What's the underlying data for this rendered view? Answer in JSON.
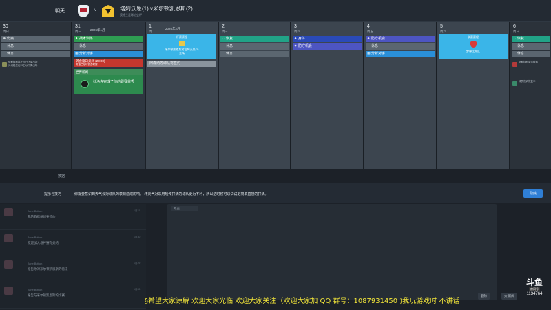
{
  "header": {
    "label": "明天",
    "vs": "v",
    "match_title": "塔姆沃思(1) v米尔顿凯恩斯(2)",
    "match_sub": "英格兰足球协会杯",
    "home_crest": "tamworth-crest-icon",
    "away_crest": "mk-dons-crest-icon"
  },
  "calendar": {
    "columns": [
      {
        "num": "30",
        "day": "周日",
        "cells": [
          "伤病",
          "休息",
          "休息"
        ]
      },
      {
        "num": "31",
        "day": "周一",
        "header_extra": "2026年1月",
        "cells": [
          "战术训练",
          "休息",
          "分析对手"
        ]
      },
      {
        "num": "1",
        "day": "周二",
        "header_extra": "2026年2月",
        "event_title": "杯赛赛程",
        "event_text": "米尔顿凯恩斯对塔姆沃思(2)",
        "event_tag": "主场"
      },
      {
        "num": "2",
        "day": "周三",
        "cells": [
          "恢复",
          "休息",
          "休息"
        ]
      },
      {
        "num": "3",
        "day": "周四",
        "cells": [
          "身体",
          "防守机会"
        ]
      },
      {
        "num": "4",
        "day": "周五",
        "cells": [
          "防守机会",
          "休息",
          "分析对手"
        ]
      },
      {
        "num": "5",
        "day": "周六",
        "event_title": "联赛赛程",
        "event_text": "梦想之湖队"
      },
      {
        "num": "6",
        "day": "周日",
        "cells": [
          "恢复",
          "休息",
          "休息"
        ]
      }
    ],
    "col0_notice": "伊斯特利将在25日下周出场\n对维格兰在25日以下周出场",
    "col1_deadline": "转会窗口关闭 (23:00)",
    "col1_deadline_sub": "英格兰足球协会联赛",
    "col1_news_head": "世界新闻",
    "col1_news": "科洛佐完成了他的联赛首秀",
    "col2_note": "阿森纳等球队将签约",
    "col7_notice1": "伊斯特利周六联赛",
    "col7_notice2": "球员伤病恢复中",
    "aside_label": "数据"
  },
  "tip": {
    "label": "提示与技巧",
    "text": "你需要意识到天气会对球队的表现造成影响。 坏天气对采用短传打法的球队更为不利，所以这时候可以试试更简单直接的打法。",
    "button": "隐藏"
  },
  "messages": [
    {
      "name": "Jane Britton",
      "text": "我的教练员想要签约",
      "date": "1月31"
    },
    {
      "name": "Jane Britton",
      "text": "欢迎加入与杯赛有关的",
      "date": "1月30"
    },
    {
      "name": "Jane Britton",
      "text": "报告你对米尔顿凯恩斯的看法",
      "date": "1月29"
    },
    {
      "name": "Jane Britton",
      "text": "报告与米尔顿凯恩斯的比赛",
      "date": "1月28"
    }
  ],
  "reader": {
    "tab": "概览"
  },
  "reply": {
    "btn1": "删除",
    "btn2": "大 新闻"
  },
  "overlay": {
    "marquee": "§希望大家谅解 欢迎大家光临  欢迎大家关注（欢迎大家加 QQ 群号：1087931450 )我玩游戏时 不讲话",
    "logo": "斗鱼",
    "room_label": "房间号",
    "room_id": "1134764"
  },
  "colors": {
    "accent_blue": "#2f7fd6",
    "cal_green": "#2e9d52",
    "cal_red": "#c5372e",
    "marquee_yellow": "#f3e63a"
  }
}
